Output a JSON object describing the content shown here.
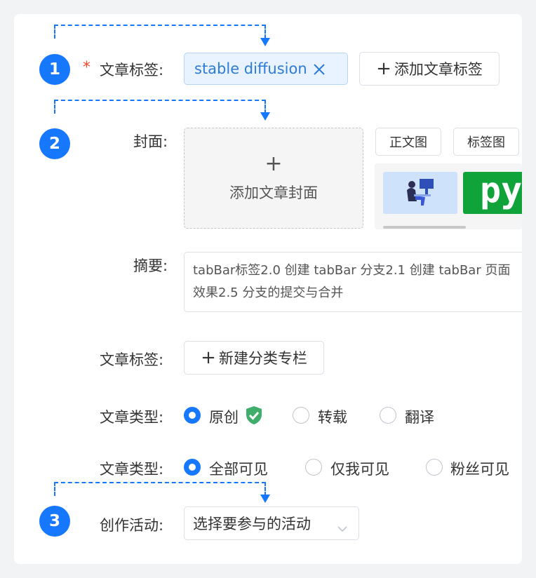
{
  "steps": [
    "1",
    "2",
    "3"
  ],
  "colors": {
    "accent": "#1677ff",
    "required": "#f5482b",
    "chip_bg": "#e8f3ff"
  },
  "row_tags": {
    "required_mark": "*",
    "label": "文章标签:",
    "chip_text": "stable diffusion",
    "chip_close_icon": "close-icon",
    "add_button_label": "添加文章标签"
  },
  "row_cover": {
    "label": "封面:",
    "add_symbol": "+",
    "add_label": "添加文章封面",
    "tabs": [
      "正文图",
      "标签图"
    ],
    "thumb_text": "py"
  },
  "row_summary": {
    "label": "摘要:",
    "lines": [
      "tabBar标签2.0 创建 tabBar 分支2.1 创建 tabBar 页面",
      "效果2.5 分支的提交与合并"
    ]
  },
  "row_column": {
    "label": "文章标签:",
    "button_label": "新建分类专栏"
  },
  "row_type": {
    "label": "文章类型:",
    "options": [
      {
        "label": "原创",
        "selected": true
      },
      {
        "label": "转载",
        "selected": false
      },
      {
        "label": "翻译",
        "selected": false
      }
    ],
    "verified_icon": "shield-check-icon"
  },
  "row_visibility": {
    "label": "文章类型:",
    "options": [
      {
        "label": "全部可见",
        "selected": true
      },
      {
        "label": "仅我可见",
        "selected": false
      },
      {
        "label": "粉丝可见",
        "selected": false
      }
    ]
  },
  "row_activity": {
    "label": "创作活动:",
    "select_value": "选择要参与的活动",
    "chevron_icon": "chevron-down-icon"
  }
}
